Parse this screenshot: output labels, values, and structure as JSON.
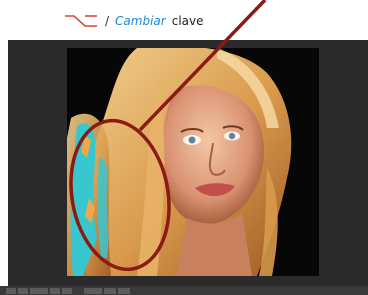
{
  "caption": {
    "icon": "option-key-icon",
    "separator": "/",
    "italic_text": "Cambiar",
    "plain_text": "clave"
  },
  "colors": {
    "callout": "#8b1a12",
    "mask_overlay": "#39c7cf",
    "panel": "#2a2a2a"
  }
}
